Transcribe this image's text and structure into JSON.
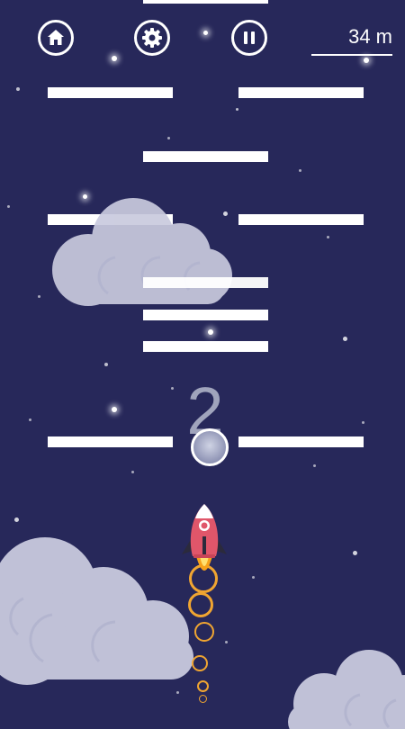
{
  "hud": {
    "home_icon": "home-icon",
    "settings_icon": "gear-icon",
    "pause_icon": "pause-icon",
    "distance": "34 m"
  },
  "game": {
    "countdown": "2",
    "background_color": "#27285a",
    "bar_color": "#ffffff",
    "cloud_color": "#c9cade",
    "rocket_body_color": "#e0566a",
    "flame_color": "#f7a21b"
  }
}
